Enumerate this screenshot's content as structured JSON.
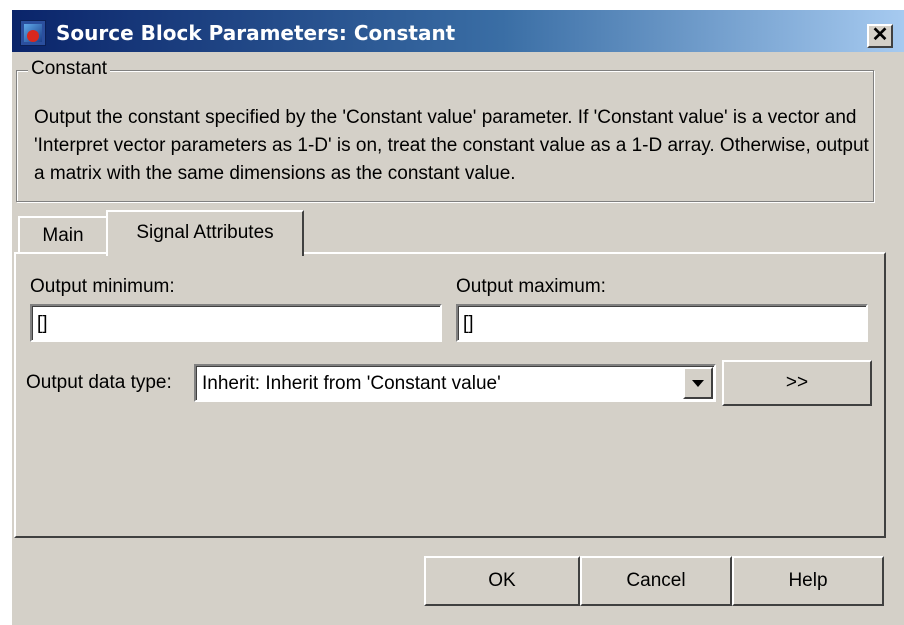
{
  "window": {
    "title": "Source Block Parameters: Constant",
    "close_symbol": "✕",
    "icon": "simulink-block-icon"
  },
  "group": {
    "title": "Constant",
    "description": "Output the constant specified by the 'Constant value' parameter. If 'Constant value' is a vector and 'Interpret vector parameters as 1-D' is on, treat the constant value as a 1-D array. Otherwise, output a matrix with the same dimensions as the constant value."
  },
  "tabs": [
    {
      "label": "Main",
      "active": false
    },
    {
      "label": "Signal Attributes",
      "active": true
    }
  ],
  "signal_attributes": {
    "output_minimum_label": "Output minimum:",
    "output_minimum_value": "[]",
    "output_maximum_label": "Output maximum:",
    "output_maximum_value": "[]",
    "data_type_label": "Output data type:",
    "data_type_value": "Inherit: Inherit from 'Constant value'",
    "more_button_label": ">>"
  },
  "buttons": {
    "ok": "OK",
    "cancel": "Cancel",
    "help": "Help"
  },
  "colors": {
    "dialog_face": "#d4d0c8",
    "titlebar_start": "#0a246a",
    "titlebar_end": "#a6caf0"
  }
}
